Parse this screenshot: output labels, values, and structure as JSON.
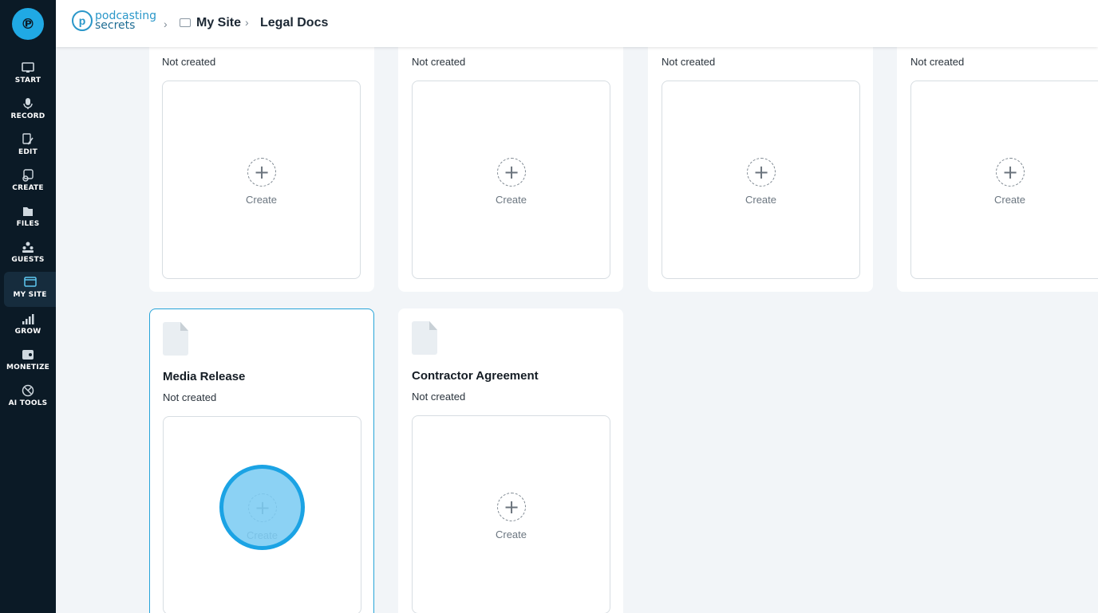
{
  "sidebar": {
    "logo_icon": "podcasting-secrets-logo-icon",
    "items": [
      {
        "label": "START",
        "icon": "start-icon"
      },
      {
        "label": "RECORD",
        "icon": "microphone-icon"
      },
      {
        "label": "EDIT",
        "icon": "edit-icon"
      },
      {
        "label": "CREATE",
        "icon": "create-icon"
      },
      {
        "label": "FILES",
        "icon": "files-icon"
      },
      {
        "label": "GUESTS",
        "icon": "guests-icon"
      },
      {
        "label": "MY SITE",
        "icon": "my-site-icon",
        "active": true
      },
      {
        "label": "GROW",
        "icon": "grow-icon"
      },
      {
        "label": "MONETIZE",
        "icon": "monetize-icon"
      },
      {
        "label": "AI TOOLS",
        "icon": "ai-tools-icon"
      }
    ]
  },
  "header": {
    "brand_line1": "podcasting",
    "brand_line2": "secrets",
    "breadcrumb": [
      "My Site",
      "Legal Docs"
    ]
  },
  "cards_top_row": [
    {
      "status": "Not created",
      "create_label": "Create"
    },
    {
      "status": "Not created",
      "create_label": "Create"
    },
    {
      "status": "Not created",
      "create_label": "Create"
    },
    {
      "status": "Not created",
      "create_label": "Create"
    }
  ],
  "cards_bottom_row": [
    {
      "title": "Media Release",
      "status": "Not created",
      "create_label": "Create",
      "selected": true
    },
    {
      "title": "Contractor Agreement",
      "status": "Not created",
      "create_label": "Create"
    }
  ],
  "colors": {
    "sidebar_bg": "#0b1a26",
    "accent": "#20a9e4",
    "page_bg": "#f2f5f8",
    "highlight": "#1ba3e4"
  }
}
